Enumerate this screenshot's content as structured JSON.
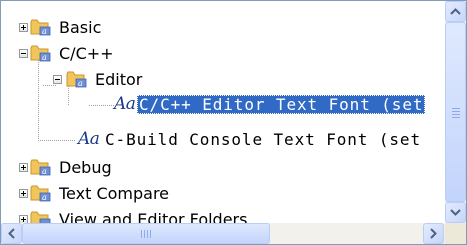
{
  "tree": {
    "items": [
      {
        "label": "Basic",
        "icon": "folder-font-icon",
        "expanded": false
      },
      {
        "label": "C/C++",
        "icon": "folder-font-icon",
        "expanded": true
      },
      {
        "label": "Editor",
        "icon": "folder-font-icon",
        "expanded": true
      },
      {
        "label": "C/C++ Editor Text Font (set",
        "icon": "font-aa-icon",
        "selected": true
      },
      {
        "label": "C-Build Console Text Font (set",
        "icon": "font-aa-icon",
        "selected": false
      },
      {
        "label": "Debug",
        "icon": "folder-font-icon",
        "expanded": false
      },
      {
        "label": "Text Compare",
        "icon": "folder-font-icon",
        "expanded": false
      },
      {
        "label": "View and Editor Folders",
        "icon": "folder-font-icon",
        "expanded": false
      }
    ],
    "font_glyph": "Aa"
  },
  "scrollbars": {
    "vertical_position": 0.0,
    "horizontal_position": 0.0
  },
  "colors": {
    "selection": "#316ac5",
    "folder": "#f2c55b",
    "aa": "#1c3a8a",
    "scroll_accent": "#4d6185"
  }
}
